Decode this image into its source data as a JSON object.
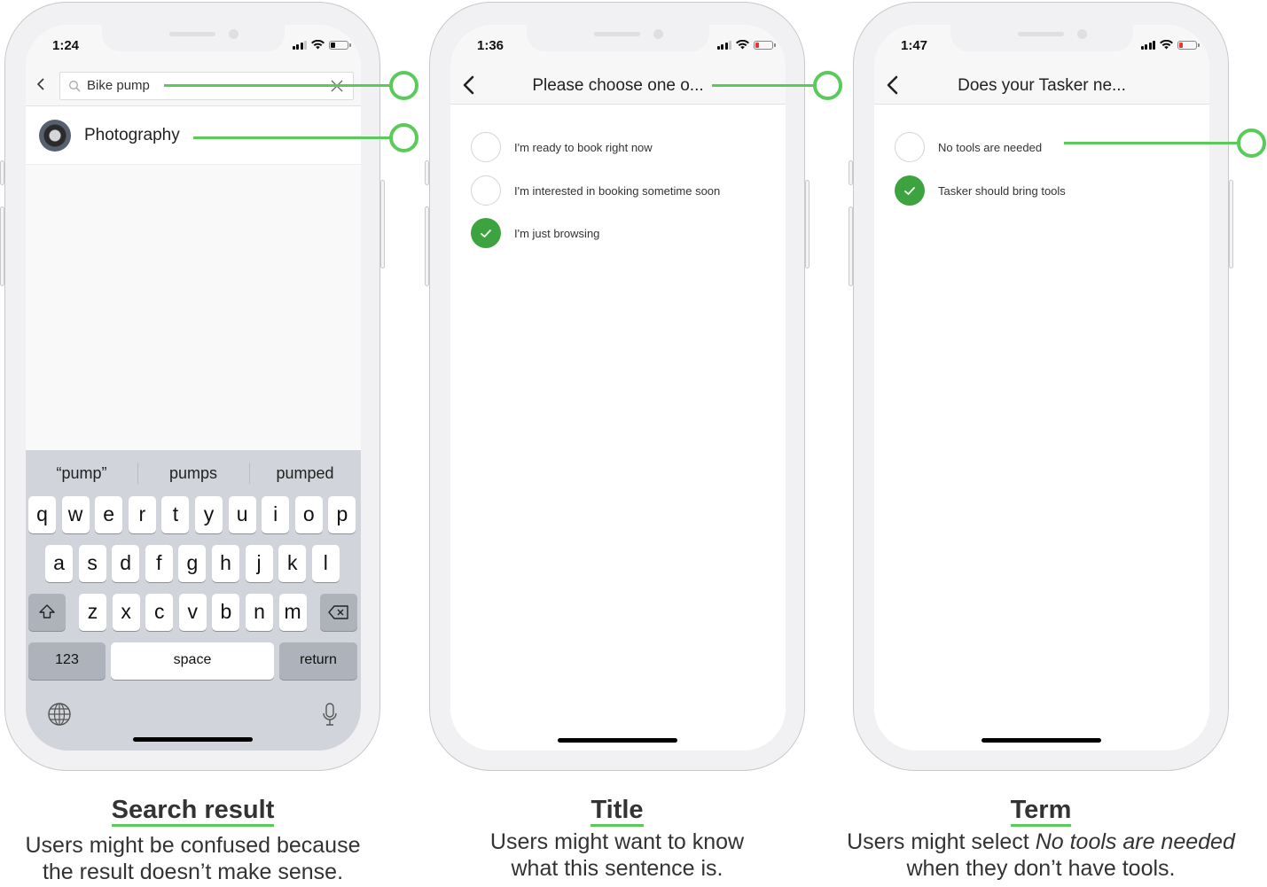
{
  "accent_color": "#5acb5a",
  "check_color": "#3ca33f",
  "phones": [
    {
      "time": "1:24",
      "battery_level": 0.3,
      "battery_color": "#111111",
      "search": {
        "value": "Bike pump",
        "search_icon": "search-icon",
        "clear_icon": "close-icon"
      },
      "results": [
        {
          "label": "Photography",
          "icon": "camera-avatar"
        }
      ],
      "keyboard": {
        "suggestions": [
          "“pump”",
          "pumps",
          "pumped"
        ],
        "row1": [
          "q",
          "w",
          "e",
          "r",
          "t",
          "y",
          "u",
          "i",
          "o",
          "p"
        ],
        "row2": [
          "a",
          "s",
          "d",
          "f",
          "g",
          "h",
          "j",
          "k",
          "l"
        ],
        "row3": [
          "z",
          "x",
          "c",
          "v",
          "b",
          "n",
          "m"
        ],
        "numbers_label": "123",
        "space_label": "space",
        "return_label": "return"
      }
    },
    {
      "time": "1:36",
      "battery_level": 0.2,
      "battery_color": "#e53935",
      "title": "Please choose one o...",
      "options": [
        {
          "label": "I'm ready to book right now",
          "checked": false
        },
        {
          "label": "I'm interested in booking sometime soon",
          "checked": false
        },
        {
          "label": "I'm just browsing",
          "checked": true
        }
      ]
    },
    {
      "time": "1:47",
      "battery_level": 0.2,
      "battery_color": "#e53935",
      "title": "Does your Tasker ne...",
      "options": [
        {
          "label": "No tools are needed",
          "checked": false
        },
        {
          "label": "Tasker should bring tools",
          "checked": true
        }
      ]
    }
  ],
  "captions": [
    {
      "title": "Search result",
      "line1": "Users might be confused because",
      "line2": "the result doesn’t make sense."
    },
    {
      "title": "Title",
      "line1": "Users might want to know",
      "line2": "what this sentence is."
    },
    {
      "title": "Term",
      "line1_prefix": "Users might select ",
      "line1_emphasis": "No tools are needed",
      "line2": "when they don’t have tools."
    }
  ]
}
